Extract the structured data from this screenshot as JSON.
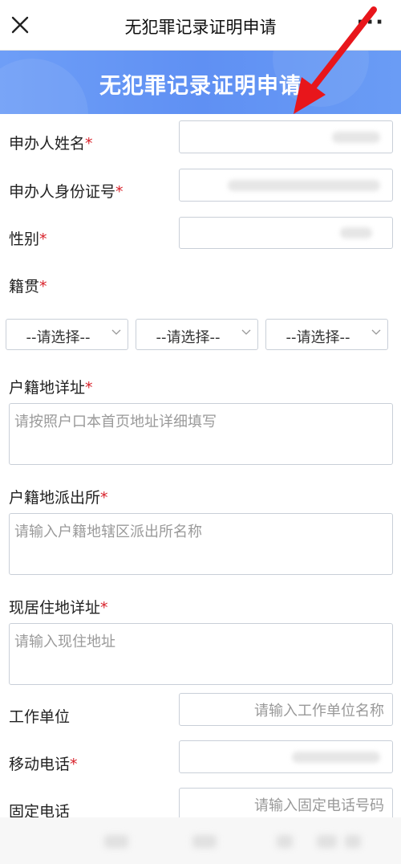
{
  "topbar": {
    "title": "无犯罪记录证明申请",
    "close_icon": "close-icon",
    "more_label": "···"
  },
  "banner": {
    "title": "无犯罪记录证明申请"
  },
  "form": {
    "applicant_name": {
      "label": "申办人姓名",
      "required": "*"
    },
    "applicant_id": {
      "label": "申办人身份证号",
      "required": "*"
    },
    "gender": {
      "label": "性别",
      "required": "*"
    },
    "native_place": {
      "label": "籍贯",
      "required": "*",
      "selects": [
        "--请选择--",
        "--请选择--",
        "--请选择--"
      ]
    },
    "household_address": {
      "label": "户籍地详址",
      "required": "*",
      "placeholder": "请按照户口本首页地址详细填写"
    },
    "household_police": {
      "label": "户籍地派出所",
      "required": "*",
      "placeholder": "请输入户籍地辖区派出所名称"
    },
    "current_address": {
      "label": "现居住地详址",
      "required": "*",
      "placeholder": "请输入现住地址"
    },
    "employer": {
      "label": "工作单位",
      "placeholder": "请输入工作单位名称"
    },
    "mobile": {
      "label": "移动电话",
      "required": "*"
    },
    "landline": {
      "label": "固定电话",
      "placeholder": "请输入固定电话号码"
    }
  },
  "colors": {
    "banner": "#5f90f3",
    "required": "#d8212a",
    "arrow": "#e8161b"
  }
}
